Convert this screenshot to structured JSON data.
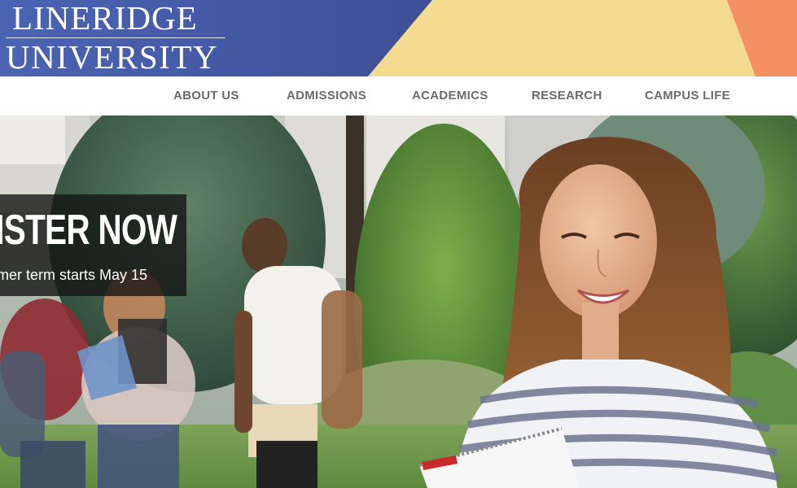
{
  "brand": {
    "line1": "LINERIDGE",
    "line2": "UNIVERSITY"
  },
  "nav": {
    "items": [
      {
        "label": "ABOUT US"
      },
      {
        "label": "ADMISSIONS"
      },
      {
        "label": "ACADEMICS"
      },
      {
        "label": "RESEARCH"
      },
      {
        "label": "CAMPUS LIFE"
      }
    ]
  },
  "hero": {
    "promo_title": "GISTER NOW",
    "promo_subtitle": "mer term starts May 15"
  },
  "colors": {
    "header_blue": "#4a5fa8",
    "header_yellow": "#f4db8f",
    "header_orange": "#f59064",
    "nav_text": "#6b6b6b"
  }
}
